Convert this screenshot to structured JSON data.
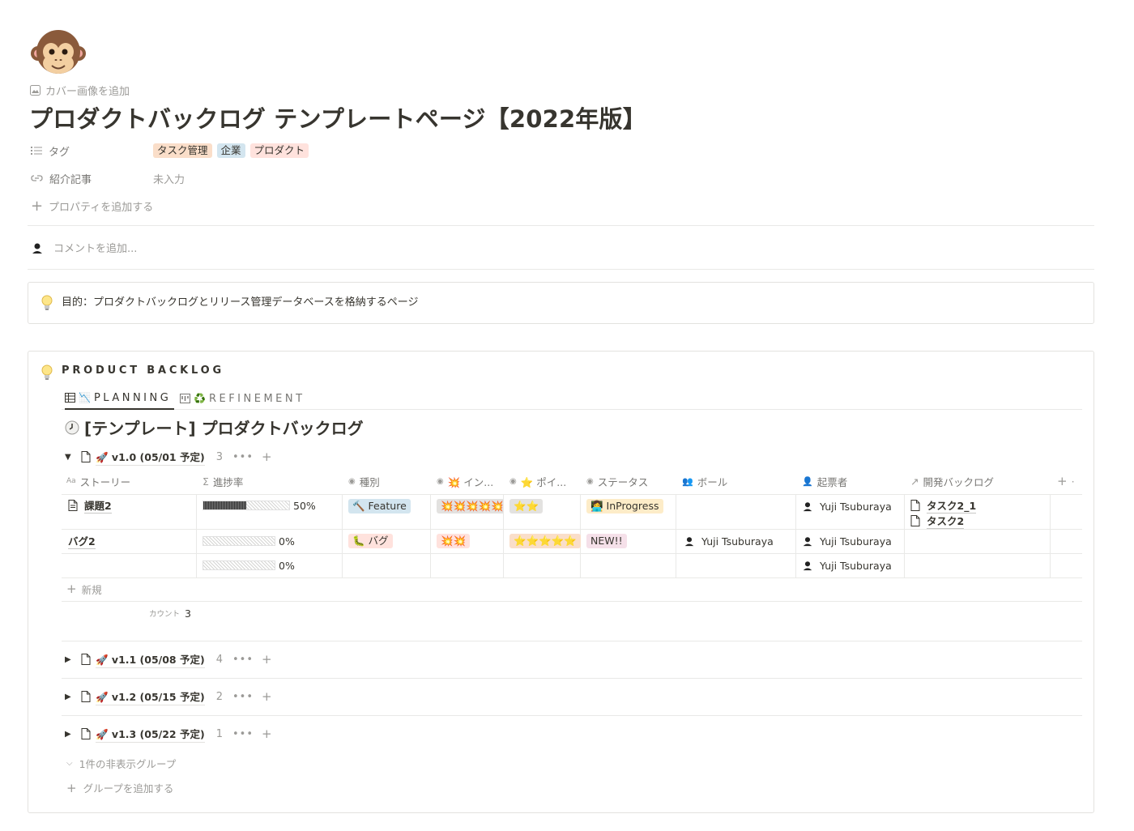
{
  "page": {
    "icon": "monkey-face-icon",
    "add_cover": "カバー画像を追加",
    "title": "プロダクトバックログ テンプレートページ【2022年版】"
  },
  "properties": {
    "tags_label": "タグ",
    "tags": [
      {
        "label": "タスク管理",
        "color": "#fadec9"
      },
      {
        "label": "企業",
        "color": "#d3e5ef"
      },
      {
        "label": "プロダクト",
        "color": "#ffe2dd"
      }
    ],
    "article_label": "紹介記事",
    "article_value": "未入力",
    "add_property": "プロパティを追加する"
  },
  "comment": {
    "placeholder": "コメントを追加..."
  },
  "callout": {
    "text": "目的：プロダクトバックログとリリース管理データベースを格納するページ"
  },
  "backlog": {
    "title": "PRODUCT BACKLOG",
    "tabs": [
      {
        "label": "PLANNING",
        "icon": "table-icon"
      },
      {
        "label": "REFINEMENT",
        "icon": "board-icon"
      }
    ],
    "db_title": "[テンプレート] プロダクトバックログ",
    "columns": {
      "story": "ストーリー",
      "progress": "進捗率",
      "type": "種別",
      "impact": "💥 イン...",
      "point": "⭐ ポイ...",
      "status": "ステータス",
      "ball": "ボール",
      "author": "起票者",
      "dev": "開発バックログ"
    },
    "group_open": {
      "name": "🚀 v1.0  (05/01 予定)",
      "count": "3"
    },
    "rows": [
      {
        "story": "課題2",
        "progress": 0.5,
        "progress_text": "50%",
        "type": "🔨 Feature",
        "type_color": "#d3e5ef",
        "impact": "💥💥💥💥💥",
        "impact_color": "#e3e2e0",
        "point": "⭐⭐",
        "point_color": "#e3e2e0",
        "status": "👩‍💻 InProgress",
        "status_color": "#fdecc8",
        "ball": "",
        "author": "Yuji Tsuburaya",
        "dev": [
          "タスク2_1",
          "タスク2"
        ]
      },
      {
        "story": "バグ2",
        "progress": 0,
        "progress_text": "0%",
        "type": "🐛 バグ",
        "type_color": "#ffe2dd",
        "impact": "💥💥",
        "impact_color": "#ffe2dd",
        "point": "⭐⭐⭐⭐⭐",
        "point_color": "#fadec9",
        "status": "NEW!!",
        "status_color": "#f5e0e9",
        "ball": "Yuji Tsuburaya",
        "author": "Yuji Tsuburaya",
        "dev": []
      },
      {
        "story": "",
        "progress": 0,
        "progress_text": "0%",
        "author": "Yuji Tsuburaya",
        "dev": []
      }
    ],
    "new_label": "新規",
    "count_label": "カウント",
    "count_value": "3",
    "groups_closed": [
      {
        "name": "🚀 v1.1  (05/08 予定)",
        "count": "4"
      },
      {
        "name": "🚀 v1.2  (05/15 予定)",
        "count": "2"
      },
      {
        "name": "🚀 v1.3  (05/22 予定)",
        "count": "1"
      }
    ],
    "hidden_groups": "1件の非表示グループ",
    "add_group": "グループを追加する"
  }
}
